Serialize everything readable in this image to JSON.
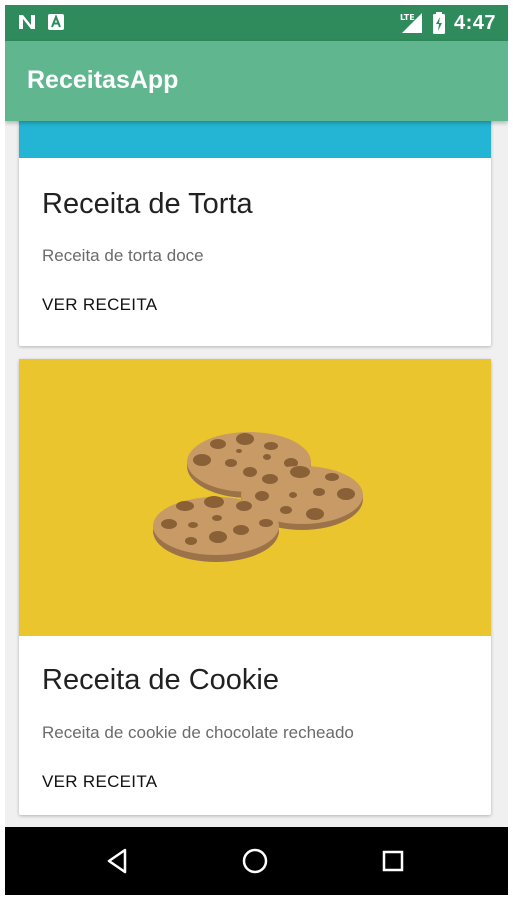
{
  "status_bar": {
    "time": "4:47",
    "network_label": "LTE",
    "left_icons": [
      "n-notification-icon",
      "a-notification-icon"
    ],
    "right_icons": [
      "lte-signal-icon",
      "battery-charging-icon"
    ],
    "color": "#2f8b5b"
  },
  "app_bar": {
    "title": "ReceitasApp",
    "color": "#60b68e"
  },
  "cards": [
    {
      "title": "Receita de Torta",
      "description": "Receita de torta doce",
      "action_label": "VER RECEITA",
      "image_color": "#23b5d3"
    },
    {
      "title": "Receita de Cookie",
      "description": "Receita de cookie de chocolate recheado",
      "action_label": "VER RECEITA",
      "image_color": "#ebc52e",
      "image_icon": "cookies-icon"
    }
  ],
  "nav_bar": {
    "icons": [
      "back-icon",
      "home-icon",
      "recents-icon"
    ]
  }
}
